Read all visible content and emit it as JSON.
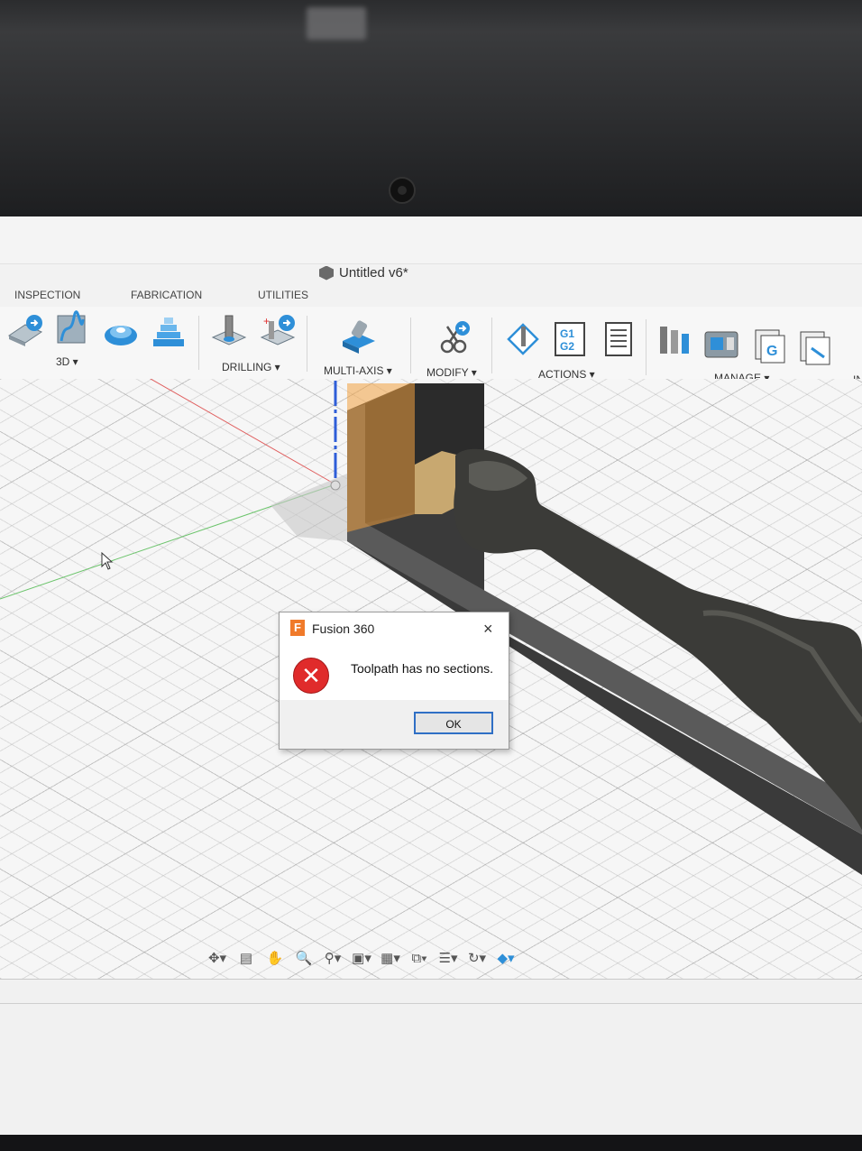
{
  "window": {
    "title": "Untitled v6*"
  },
  "tabs": [
    {
      "label": "INSPECTION"
    },
    {
      "label": "FABRICATION"
    },
    {
      "label": "UTILITIES"
    }
  ],
  "toolbar": {
    "groups": [
      {
        "label": "3D ▾"
      },
      {
        "label": "DRILLING ▾"
      },
      {
        "label": "MULTI-AXIS ▾"
      },
      {
        "label": "MODIFY ▾"
      },
      {
        "label": "ACTIONS ▾"
      },
      {
        "label": "MANAGE ▾"
      }
    ],
    "gcode_icon_text": "G1\nG2",
    "overflow_label": "IN"
  },
  "dialog": {
    "title": "Fusion 360",
    "logo": "F",
    "close": "×",
    "message": "Toolpath has no sections.",
    "ok_label": "OK",
    "icon": "error-icon"
  },
  "navbar": {
    "icons": [
      "orbit-icon",
      "look-at-icon",
      "pan-icon",
      "zoom-icon",
      "zoom-window-icon",
      "display-settings-icon",
      "grid-icon",
      "view-cube-icon",
      "effects-icon",
      "refresh-icon",
      "shaded-icon"
    ]
  },
  "colors": {
    "accent": "#2f6fc5",
    "error": "#e02b2b",
    "stock_orange": "#f0a040"
  }
}
